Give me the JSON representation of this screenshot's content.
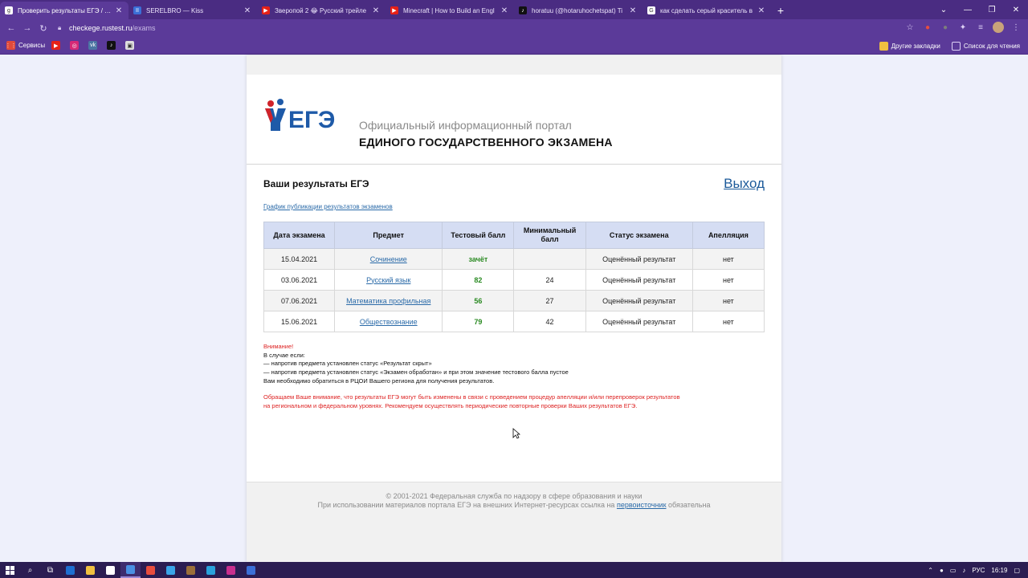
{
  "browser": {
    "tabs": [
      {
        "title": "Проверить результаты ЕГЭ / Оф",
        "fav_color": "#ffffff",
        "fav_glyph": "g",
        "active": true
      },
      {
        "title": "SERELBRO — Kiss",
        "fav_color": "#3b6fd6",
        "fav_glyph": "II",
        "active": false
      },
      {
        "title": "Зверопой 2 😂 Русский трейле",
        "fav_color": "#e62117",
        "fav_glyph": "▶",
        "active": false
      },
      {
        "title": "Minecraft | How to Build an Engl",
        "fav_color": "#e62117",
        "fav_glyph": "▶",
        "active": false
      },
      {
        "title": "horatuu (@hotaruhochetspat) Ti",
        "fav_color": "#111111",
        "fav_glyph": "♪",
        "active": false
      },
      {
        "title": "как сделать серый краситель в",
        "fav_color": "#ffffff",
        "fav_glyph": "G",
        "active": false
      }
    ],
    "new_tab": "+",
    "url_host": "checkege.rustest.ru",
    "url_path": "/exams",
    "bookmarks": [
      {
        "label": "Сервисы",
        "color": "#e04a3b",
        "glyph": "⋮⋮"
      },
      {
        "label": "",
        "color": "#e62117",
        "glyph": "▶"
      },
      {
        "label": "",
        "color": "#d62976",
        "glyph": "◎"
      },
      {
        "label": "",
        "color": "#4c75a3",
        "glyph": "vk"
      },
      {
        "label": "",
        "color": "#111111",
        "glyph": "♪"
      },
      {
        "label": "",
        "color": "#dddddd",
        "glyph": "▣"
      }
    ],
    "other_bookmarks": "Другие закладки",
    "reading_list": "Список для чтения"
  },
  "header": {
    "logo_text": "ЕГЭ",
    "portal_line1": "Официальный информационный портал",
    "portal_line2": "ЕДИНОГО ГОСУДАРСТВЕННОГО ЭКЗАМЕНА"
  },
  "main": {
    "title": "Ваши результаты ЕГЭ",
    "logout": "Выход",
    "schedule_link": "График публикации результатов экзаменов",
    "columns": [
      "Дата экзамена",
      "Предмет",
      "Тестовый балл",
      "Минимальный балл",
      "Статус экзамена",
      "Апелляция"
    ],
    "rows": [
      {
        "date": "15.04.2021",
        "subject": "Сочинение",
        "score": "зачёт",
        "min": "",
        "status": "Оценённый результат",
        "appeal": "нет"
      },
      {
        "date": "03.06.2021",
        "subject": "Русский язык",
        "score": "82",
        "min": "24",
        "status": "Оценённый результат",
        "appeal": "нет"
      },
      {
        "date": "07.06.2021",
        "subject": "Математика профильная",
        "score": "56",
        "min": "27",
        "status": "Оценённый результат",
        "appeal": "нет"
      },
      {
        "date": "15.06.2021",
        "subject": "Обществознание",
        "score": "79",
        "min": "42",
        "status": "Оценённый результат",
        "appeal": "нет"
      }
    ],
    "notice_title": "Внимание!",
    "notice_lines": [
      "В случае если:",
      "— напротив предмета установлен статус «Результат скрыт»",
      "— напротив предмета установлен статус «Экзамен обработан» и при этом значение тестового балла пустое",
      "Вам необходимо обратиться в РЦОИ Вашего региона для получения результатов."
    ],
    "notice2_line1": "Обращаем Ваше внимание, что результаты ЕГЭ могут быть изменены в связи с проведением процедур апелляции и/или перепроверок результатов",
    "notice2_line2": "на региональном и федеральном уровнях. Рекомендуем осуществлять периодические повторные проверки Ваших результатов ЕГЭ."
  },
  "footer": {
    "line1": "© 2001-2021 Федеральная служба по надзору в сфере образования и науки",
    "line2_before": "При использовании материалов портала ЕГЭ на внешних Интернет-ресурсах ссылка на",
    "line2_link": "первоисточник",
    "line2_after": "обязательна"
  },
  "taskbar": {
    "apps": [
      "#1e6fd0",
      "#f0c040",
      "#ffffff",
      "#4a90e2",
      "#e84d3d",
      "#3aa5e8",
      "#9b6f3a",
      "#2aa2dc",
      "#c92f8e",
      "#3b6fd6"
    ],
    "lang": "РУС",
    "time": "16:19"
  },
  "colors": {
    "accent": "#5b3a99",
    "link": "#2a6aa8",
    "score_green": "#2a8a22",
    "warning_red": "#dd2222",
    "table_header": "#d5ddf3"
  }
}
